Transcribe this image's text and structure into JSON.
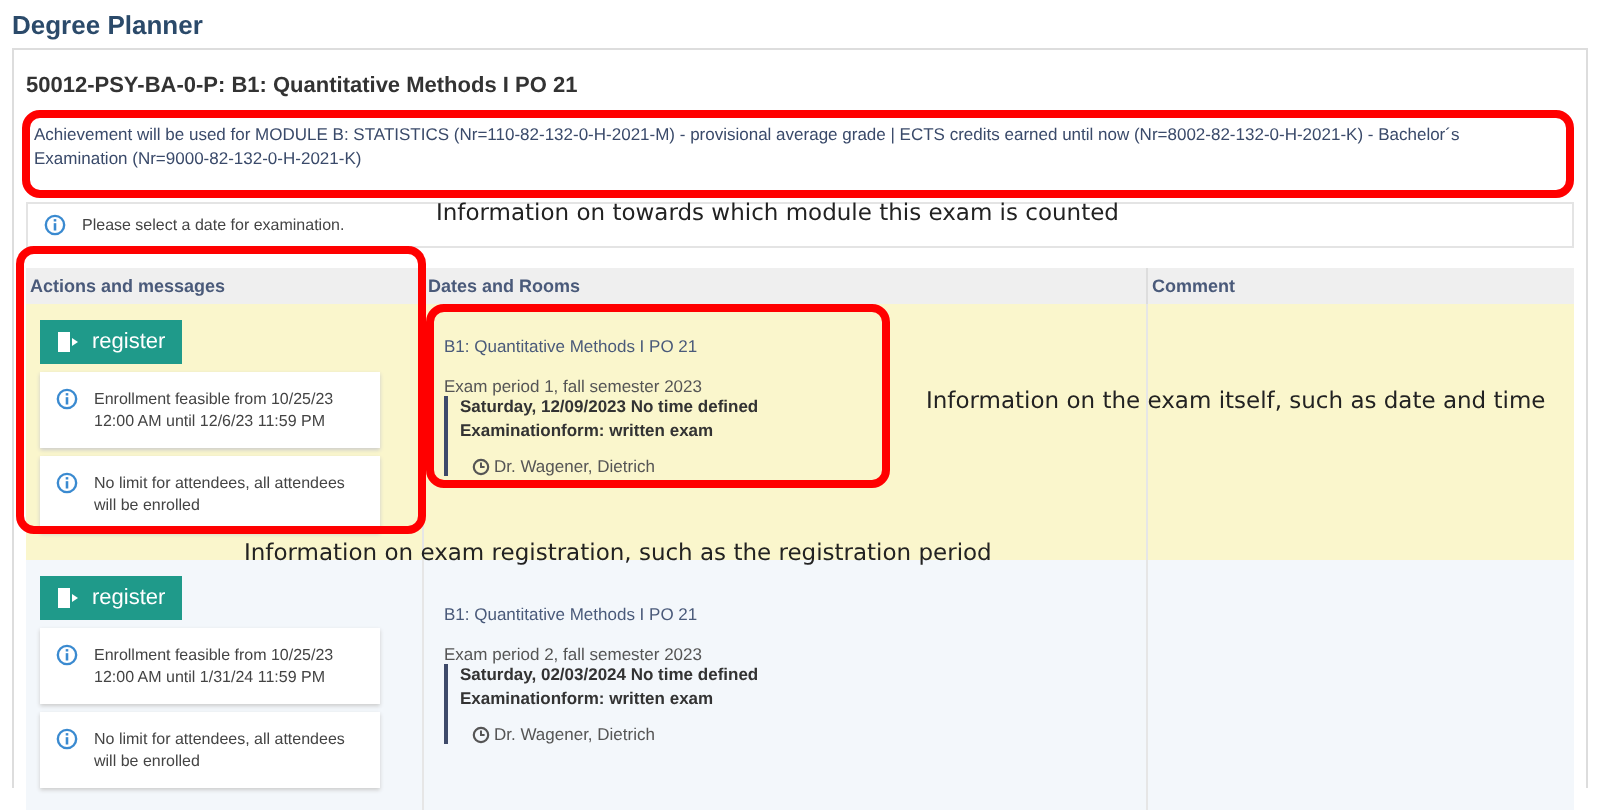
{
  "page_title": "Degree Planner",
  "module": {
    "title": "50012-PSY-BA-0-P: B1: Quantitative Methods I PO 21",
    "achievement": "Achievement will be used for MODULE B: STATISTICS (Nr=110-82-132-0-H-2021-M) - provisional average grade | ECTS credits earned until now (Nr=8002-82-132-0-H-2021-K) - Bachelor´s Examination (Nr=9000-82-132-0-H-2021-K)",
    "notice": "Please select a date for examination."
  },
  "table": {
    "columns": [
      "Actions and messages",
      "Dates and Rooms",
      "Comment"
    ],
    "rows": [
      {
        "highlighted": true,
        "button": "register",
        "messages": [
          "Enrollment feasible from 10/25/23 12:00 AM until 12/6/23 11:59 PM",
          "No limit for attendees, all attendees will be enrolled"
        ],
        "course": "B1: Quantitative Methods I PO 21",
        "period": "Exam period 1, fall semester 2023",
        "date": "Saturday, 12/09/2023 No time defined",
        "form": "Examinationform: written exam",
        "examiner": "Dr. Wagener, Dietrich"
      },
      {
        "highlighted": false,
        "button": "register",
        "messages": [
          "Enrollment feasible from 10/25/23 12:00 AM until 1/31/24 11:59 PM",
          "No limit for attendees, all attendees will be enrolled"
        ],
        "course": "B1: Quantitative Methods I PO 21",
        "period": "Exam period 2, fall semester 2023",
        "date": "Saturday, 02/03/2024 No time defined",
        "form": "Examinationform: written exam",
        "examiner": "Dr. Wagener, Dietrich"
      }
    ]
  },
  "annotations": [
    "Information on towards which module this exam is counted",
    "Information on the exam itself, such as date and time",
    "Information on exam registration, such as the registration period"
  ]
}
